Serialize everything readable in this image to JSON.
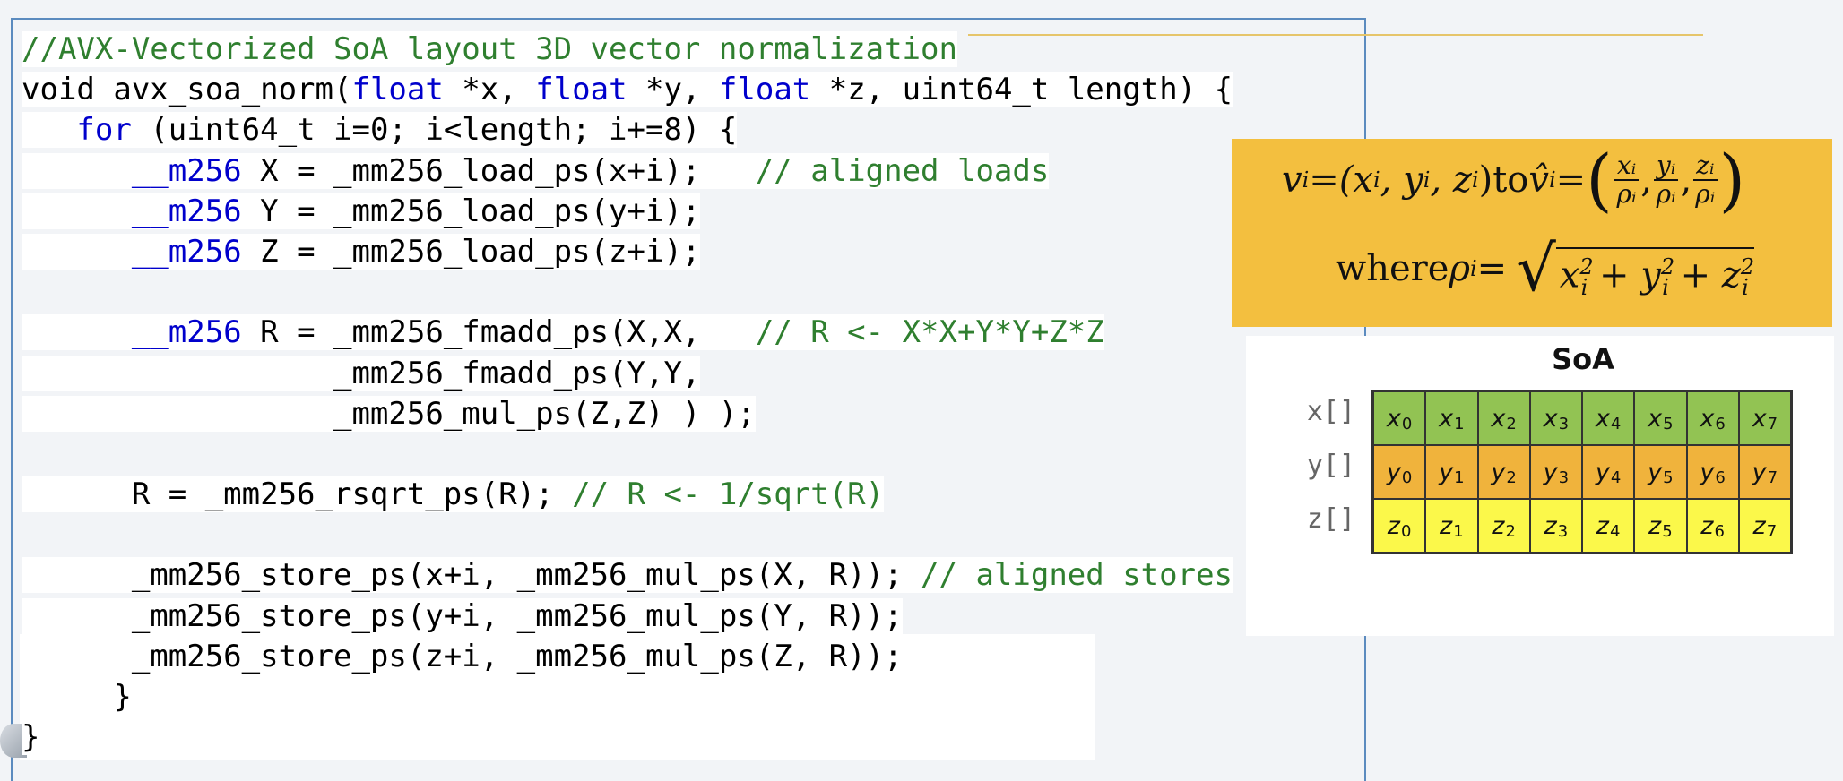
{
  "code_lines": [
    [
      {
        "t": "//AVX-Vectorized SoA layout 3D vector normalization",
        "c": "cm"
      }
    ],
    [
      {
        "t": "void",
        "c": ""
      },
      {
        "t": " avx_soa_norm(",
        "c": ""
      },
      {
        "t": "float",
        "c": "kw"
      },
      {
        "t": " *x, ",
        "c": ""
      },
      {
        "t": "float",
        "c": "kw"
      },
      {
        "t": " *y, ",
        "c": ""
      },
      {
        "t": "float",
        "c": "kw"
      },
      {
        "t": " *z, uint64_t length) {",
        "c": ""
      }
    ],
    [
      {
        "t": "   ",
        "c": ""
      },
      {
        "t": "for",
        "c": "kw"
      },
      {
        "t": " (uint64_t i=0; i<length; i+=8) {",
        "c": ""
      }
    ],
    [
      {
        "t": "      ",
        "c": ""
      },
      {
        "t": "__m256",
        "c": "kw"
      },
      {
        "t": " X = _mm256_load_ps(x+i);   ",
        "c": ""
      },
      {
        "t": "// aligned loads",
        "c": "cm"
      }
    ],
    [
      {
        "t": "      ",
        "c": ""
      },
      {
        "t": "__m256",
        "c": "kw"
      },
      {
        "t": " Y = _mm256_load_ps(y+i);",
        "c": ""
      }
    ],
    [
      {
        "t": "      ",
        "c": ""
      },
      {
        "t": "__m256",
        "c": "kw"
      },
      {
        "t": " Z = _mm256_load_ps(z+i);",
        "c": ""
      }
    ],
    [
      {
        "t": "",
        "c": ""
      }
    ],
    [
      {
        "t": "      ",
        "c": ""
      },
      {
        "t": "__m256",
        "c": "kw"
      },
      {
        "t": " R = _mm256_fmadd_ps(X,X,   ",
        "c": ""
      },
      {
        "t": "// R <- X*X+Y*Y+Z*Z",
        "c": "cm"
      }
    ],
    [
      {
        "t": "                 _mm256_fmadd_ps(Y,Y,",
        "c": ""
      }
    ],
    [
      {
        "t": "                 _mm256_mul_ps(Z,Z) ) );",
        "c": ""
      }
    ],
    [
      {
        "t": "",
        "c": ""
      }
    ],
    [
      {
        "t": "      R = _mm256_rsqrt_ps(R); ",
        "c": ""
      },
      {
        "t": "// R <- 1/sqrt(R)",
        "c": "cm"
      }
    ],
    [
      {
        "t": "",
        "c": ""
      }
    ],
    [
      {
        "t": "      _mm256_store_ps(x+i, _mm256_mul_ps(X, R)); ",
        "c": ""
      },
      {
        "t": "// aligned stores",
        "c": "cm"
      }
    ],
    [
      {
        "t": "      _mm256_store_ps(y+i, _mm256_mul_ps(Y, R));",
        "c": ""
      }
    ],
    [
      {
        "t": "      _mm256_store_ps(z+i, _mm256_mul_ps(Z, R));",
        "c": ""
      }
    ],
    [
      {
        "t": "     }",
        "c": ""
      }
    ],
    [
      {
        "t": "}",
        "c": ""
      }
    ]
  ],
  "formula": {
    "line1_v": "v",
    "sub_i": "i",
    "eq": " = ",
    "tuple": "(x",
    "comma_y": ", y",
    "comma_z": ", z",
    "close": ")",
    "to": " to ",
    "vhat": "v̂",
    "paren_open": "(",
    "paren_close": ")",
    "frac_x_num": "xᵢ",
    "frac_y_num": "yᵢ",
    "frac_z_num": "zᵢ",
    "frac_den": "ρᵢ",
    "sep": ",",
    "where": "where ",
    "rho": "ρ",
    "sum_x": "x",
    "sum_y": " + y",
    "sum_z": " + z",
    "sq": "2"
  },
  "soa": {
    "title": "SoA",
    "rows": [
      {
        "label": "x[]",
        "letter": "x",
        "color": "#92c353"
      },
      {
        "label": "y[]",
        "letter": "y",
        "color": "#f0b33c"
      },
      {
        "label": "z[]",
        "letter": "z",
        "color": "#fbf84a"
      }
    ],
    "indices": [
      "0",
      "1",
      "2",
      "3",
      "4",
      "5",
      "6",
      "7"
    ]
  }
}
